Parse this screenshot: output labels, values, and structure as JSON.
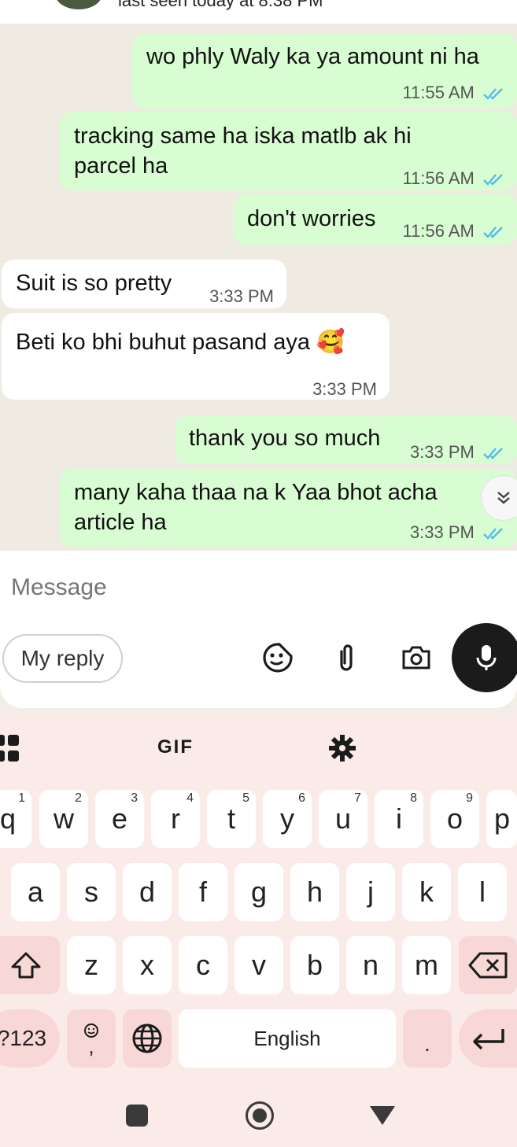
{
  "header": {
    "last_seen": "last seen today at 8:38 PM"
  },
  "messages": [
    {
      "text": "wo phly Waly ka ya amount ni ha",
      "time": "11:55 AM",
      "direction": "out"
    },
    {
      "text": "tracking same ha iska matlb ak hi parcel ha",
      "time": "11:56 AM",
      "direction": "out"
    },
    {
      "text": "don't worries",
      "time": "11:56 AM",
      "direction": "out"
    },
    {
      "text": "Suit is so pretty",
      "time": "3:33 PM",
      "direction": "in"
    },
    {
      "text": "Beti ko bhi buhut pasand aya 🥰",
      "time": "3:33 PM",
      "direction": "in"
    },
    {
      "text": "thank you so much",
      "time": "3:33 PM",
      "direction": "out"
    },
    {
      "text": "many kaha thaa na k Yaa bhot acha article ha",
      "time": "3:33 PM",
      "direction": "out"
    }
  ],
  "composer": {
    "placeholder": "Message",
    "reply_chip": "My reply"
  },
  "keyboard": {
    "toolbar": {
      "gif": "GIF"
    },
    "row1": [
      {
        "k": "q",
        "n": "1"
      },
      {
        "k": "w",
        "n": "2"
      },
      {
        "k": "e",
        "n": "3"
      },
      {
        "k": "r",
        "n": "4"
      },
      {
        "k": "t",
        "n": "5"
      },
      {
        "k": "y",
        "n": "6"
      },
      {
        "k": "u",
        "n": "7"
      },
      {
        "k": "i",
        "n": "8"
      },
      {
        "k": "o",
        "n": "9"
      },
      {
        "k": "p",
        "n": ""
      }
    ],
    "row2": [
      "a",
      "s",
      "d",
      "f",
      "g",
      "h",
      "j",
      "k",
      "l"
    ],
    "row3": [
      "z",
      "x",
      "c",
      "v",
      "b",
      "n",
      "m"
    ],
    "symbols": "?123",
    "comma": ",",
    "space": "English",
    "period": "."
  },
  "colors": {
    "outgoing": "#d9fdd3",
    "incoming": "#ffffff",
    "tick_blue": "#53bdeb",
    "keyboard_bg": "#fbebe8"
  }
}
